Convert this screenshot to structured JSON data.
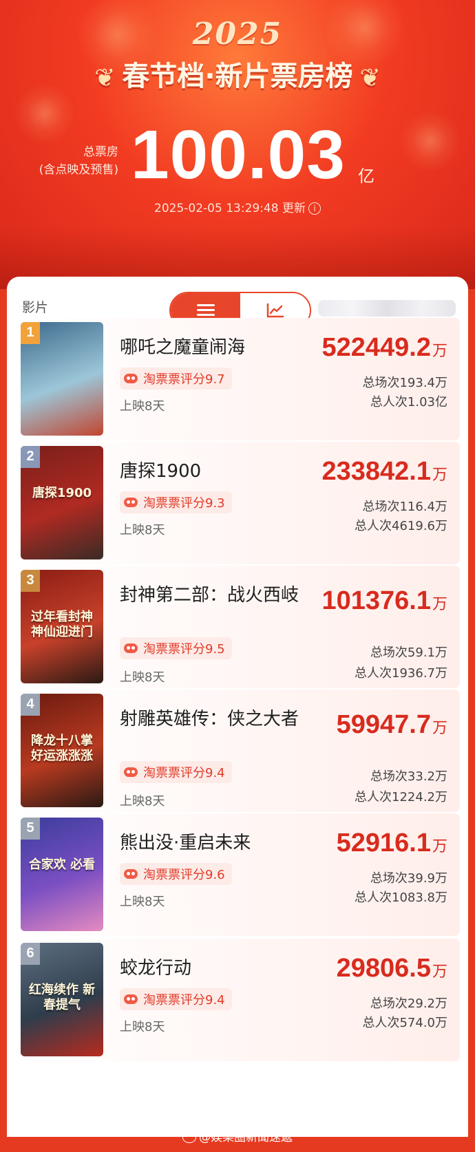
{
  "header": {
    "year": "2025",
    "title": "春节档·新片票房榜",
    "total_label_line1": "总票房",
    "total_label_line2": "(含点映及预售)",
    "total_value": "100.03",
    "total_unit": "亿",
    "update_time": "2025-02-05 13:29:48 更新",
    "info_icon": "i"
  },
  "toolbar": {
    "column_label": "影片",
    "view_list": "list-icon",
    "view_trend": "trend-chart-icon"
  },
  "colors": {
    "brand_red": "#e8462b",
    "gross_red": "#d82b1e",
    "rank1": "#f2a23a",
    "rank2": "#8a98b8",
    "rank3": "#c8893e",
    "rank_other": "#9aa3b2"
  },
  "movies": [
    {
      "rank": "1",
      "name": "哪吒之魔童闹海",
      "rating": "淘票票评分9.7",
      "days": "上映8天",
      "gross": "522449.2",
      "unit": "万",
      "shows": "总场次193.4万",
      "admissions": "总人次1.03亿"
    },
    {
      "rank": "2",
      "name": "唐探1900",
      "rating": "淘票票评分9.3",
      "days": "上映8天",
      "gross": "233842.1",
      "unit": "万",
      "shows": "总场次116.4万",
      "admissions": "总人次4619.6万"
    },
    {
      "rank": "3",
      "name": "封神第二部：战火西岐",
      "rating": "淘票票评分9.5",
      "days": "上映8天",
      "gross": "101376.1",
      "unit": "万",
      "shows": "总场次59.1万",
      "admissions": "总人次1936.7万"
    },
    {
      "rank": "4",
      "name": "射雕英雄传：侠之大者",
      "rating": "淘票票评分9.4",
      "days": "上映8天",
      "gross": "59947.7",
      "unit": "万",
      "shows": "总场次33.2万",
      "admissions": "总人次1224.2万"
    },
    {
      "rank": "5",
      "name": "熊出没·重启未来",
      "rating": "淘票票评分9.6",
      "days": "上映8天",
      "gross": "52916.1",
      "unit": "万",
      "shows": "总场次39.9万",
      "admissions": "总人次1083.8万"
    },
    {
      "rank": "6",
      "name": "蛟龙行动",
      "rating": "淘票票评分9.4",
      "days": "上映8天",
      "gross": "29806.5",
      "unit": "万",
      "shows": "总场次29.2万",
      "admissions": "总人次574.0万"
    }
  ],
  "posters": [
    {
      "name": "poster-nezha",
      "colors": [
        "#3d6a8c",
        "#9cc6d8",
        "#c2452f"
      ],
      "text": ""
    },
    {
      "name": "poster-tangtan",
      "colors": [
        "#7a1f1a",
        "#b02a22",
        "#3a2b26"
      ],
      "text": "唐探1900"
    },
    {
      "name": "poster-fengshen",
      "colors": [
        "#8a1d14",
        "#c8412a",
        "#2a1a14"
      ],
      "text": "过年看封神 神仙迎进门"
    },
    {
      "name": "poster-shediao",
      "colors": [
        "#6a1a10",
        "#b83a20",
        "#2b1a14"
      ],
      "text": "降龙十八掌 好运涨涨涨"
    },
    {
      "name": "poster-xiongchumo",
      "colors": [
        "#3a3d9c",
        "#7b4fc2",
        "#e58bc0"
      ],
      "text": "合家欢 必看"
    },
    {
      "name": "poster-jiaolong",
      "colors": [
        "#5d6f80",
        "#2f3d4c",
        "#b82a1e"
      ],
      "text": "红海续作 新春提气"
    }
  ],
  "footer": {
    "watermark": "@娱樂圈新聞速遞"
  }
}
